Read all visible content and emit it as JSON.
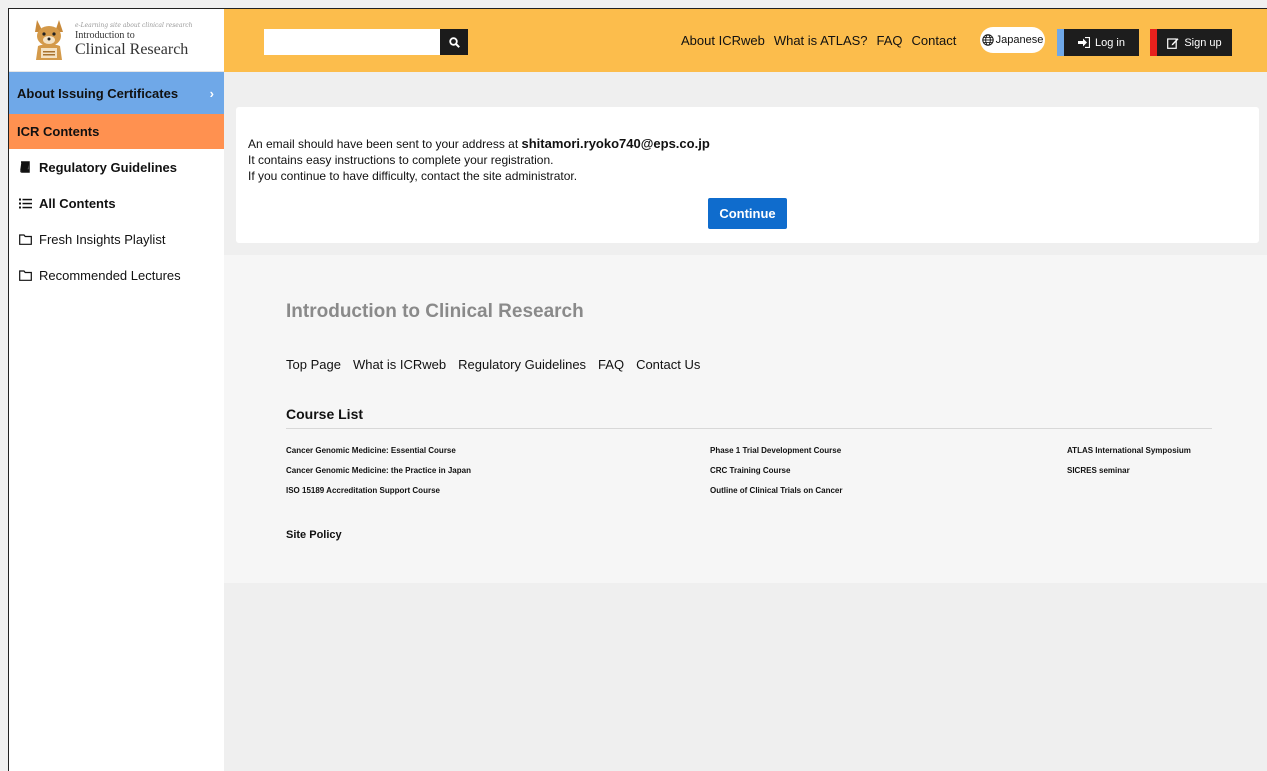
{
  "logo": {
    "tagline": "e-Learning site about clinical research",
    "small": "Introduction to",
    "big": "Clinical Research"
  },
  "sidebar": {
    "cert_label": "About Issuing Certificates",
    "cert_chevron": "›",
    "icr_label": "ICR Contents",
    "items": [
      {
        "label": "Regulatory Guidelines",
        "icon": "book-icon"
      },
      {
        "label": "All Contents",
        "icon": "list-icon"
      },
      {
        "label": "Fresh Insights Playlist",
        "icon": "folder-icon"
      },
      {
        "label": "Recommended Lectures",
        "icon": "folder-icon"
      }
    ]
  },
  "header": {
    "search_value": "",
    "search_icon": "search-icon",
    "nav": [
      "About ICRweb",
      "What is ATLAS?",
      "FAQ",
      "Contact"
    ],
    "language": "Japanese",
    "login": "Log in",
    "signup": "Sign up"
  },
  "message": {
    "line1_prefix": "An email should have been sent to your address at ",
    "email": "shitamori.ryoko740@eps.co.jp",
    "line2": "It contains easy instructions to complete your registration.",
    "line3": "If you continue to have difficulty, contact the site administrator.",
    "continue_label": "Continue"
  },
  "footer": {
    "title": "Introduction to Clinical Research",
    "links": [
      "Top Page",
      "What is ICRweb",
      "Regulatory Guidelines",
      "FAQ",
      "Contact Us"
    ],
    "course_heading": "Course List",
    "courses_col1": [
      "Cancer Genomic Medicine: Essential Course",
      "Cancer Genomic Medicine: the Practice in Japan",
      "ISO 15189 Accreditation Support Course"
    ],
    "courses_col2": [
      "Phase 1 Trial Development Course",
      "CRC Training Course",
      "Outline of Clinical Trials on Cancer"
    ],
    "courses_col3": [
      "ATLAS International Symposium",
      "SICRES seminar"
    ],
    "site_policy": "Site Policy"
  },
  "colors": {
    "header_bg": "#fcbd4c",
    "cert_bg": "#6fa8e8",
    "icr_bg": "#ff9150",
    "continue_bg": "#0f6ccd",
    "signup_accent": "#e8211d"
  }
}
